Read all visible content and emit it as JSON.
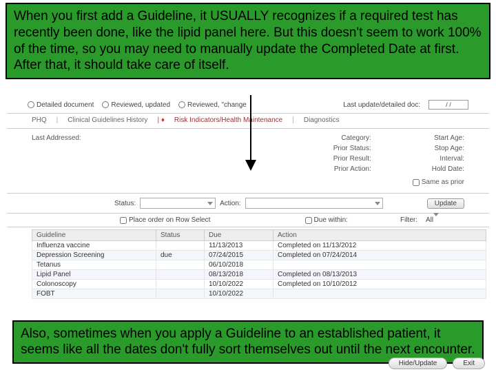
{
  "callout_top": "When you first add a Guideline, it USUALLY recognizes if a required test has recently been done, like the lipid panel here. But this doesn't seem to work 100% of the time, so you may need to manually update the Completed Date at first. After that, it should take care of itself.",
  "callout_bottom": "Also, sometimes when you apply a Guideline to an established patient, it seems like all the dates don't fully sort themselves out until the next encounter.",
  "toolbar": {
    "detailed": "Detailed document",
    "reviewed_updated": "Reviewed, updated",
    "reviewed_change": "Reviewed, \"change",
    "last_update": "Last update/detailed doc:",
    "date_value": "/  /"
  },
  "tabs": {
    "phq": "PHQ",
    "clin": "Clinical Guidelines History",
    "risk": "Risk Indicators/Health Maintenance",
    "diag": "Diagnostics"
  },
  "info": {
    "last_addressed": "Last Addressed:",
    "category": "Category:",
    "prior_status": "Prior Status:",
    "prior_result": "Prior Result:",
    "prior_action": "Prior Action:",
    "start_age": "Start Age:",
    "stop_age": "Stop Age:",
    "interval": "Interval:",
    "hold_date": "Hold Date:",
    "same_as_prior": "Same as prior"
  },
  "actionrow": {
    "status": "Status:",
    "action": "Action:",
    "update": "Update"
  },
  "filterrow": {
    "place_order": "Place order on Row Select",
    "due_within": "Due within:",
    "filter": "Filter:",
    "filter_val": "All"
  },
  "columns": {
    "guideline": "Guideline",
    "status": "Status",
    "due": "Due",
    "action": "Action"
  },
  "rows": [
    {
      "g": "Influenza vaccine",
      "s": "",
      "d": "11/13/2013",
      "a": "Completed on 11/13/2012"
    },
    {
      "g": "Depression Screening",
      "s": "due",
      "d": "07/24/2015",
      "a": "Completed on 07/24/2014"
    },
    {
      "g": "Tetanus",
      "s": "",
      "d": "06/10/2018",
      "a": ""
    },
    {
      "g": "Lipid Panel",
      "s": "",
      "d": "08/13/2018",
      "a": "Completed on 08/13/2013"
    },
    {
      "g": "Colonoscopy",
      "s": "",
      "d": "10/10/2022",
      "a": "Completed on 10/10/2012"
    },
    {
      "g": "FOBT",
      "s": "",
      "d": "10/10/2022",
      "a": ""
    }
  ],
  "buttons": {
    "hide": "Hide/Update",
    "exit": "Exit"
  }
}
